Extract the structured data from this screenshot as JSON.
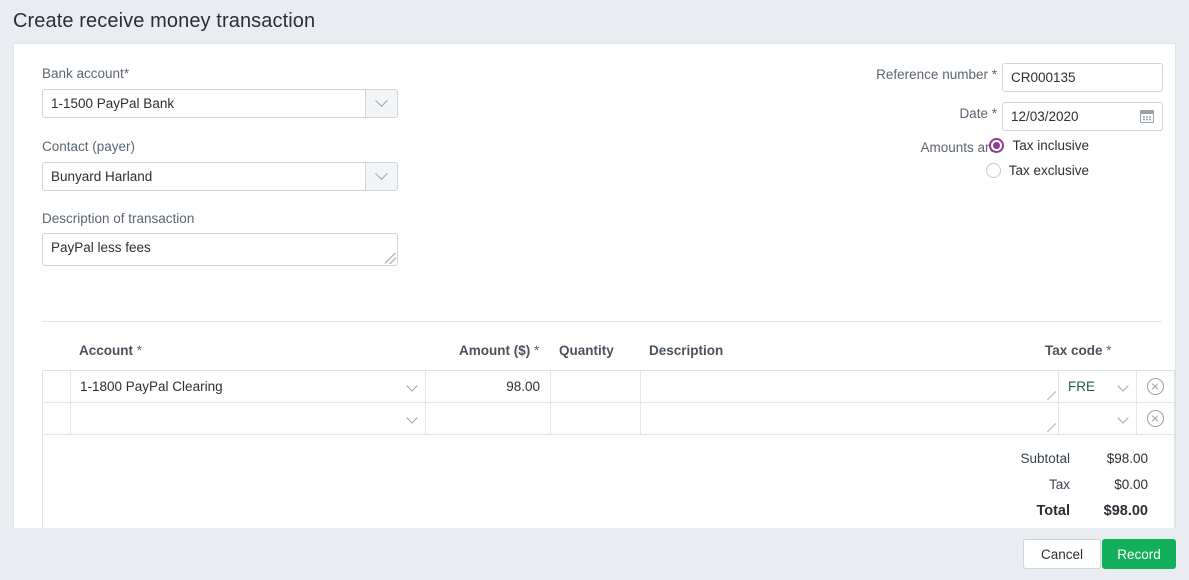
{
  "header": {
    "title": "Create receive money transaction"
  },
  "form": {
    "bank_account": {
      "label": "Bank account",
      "required": "*",
      "value": "1-1500 PayPal Bank",
      "chevron_icon": "chevron-down-icon"
    },
    "contact": {
      "label": "Contact (payer)",
      "required": "",
      "value": "Bunyard Harland",
      "chevron_icon": "chevron-down-icon"
    },
    "description": {
      "label": "Description of transaction",
      "value": "PayPal less fees"
    },
    "reference_number": {
      "label": "Reference number",
      "required": "*",
      "value": "CR000135"
    },
    "date": {
      "label": "Date",
      "required": "*",
      "value": "12/03/2020",
      "calendar_icon": "calendar-icon"
    },
    "amounts_are": {
      "label": "Amounts are",
      "options": [
        {
          "label": "Tax inclusive",
          "selected": true
        },
        {
          "label": "Tax exclusive",
          "selected": false
        }
      ]
    }
  },
  "line_items": {
    "columns": [
      {
        "key": "account",
        "label": "Account",
        "required": "*"
      },
      {
        "key": "amount",
        "label": "Amount ($)",
        "required": "*"
      },
      {
        "key": "quantity",
        "label": "Quantity",
        "required": ""
      },
      {
        "key": "description",
        "label": "Description",
        "required": ""
      },
      {
        "key": "tax_code",
        "label": "Tax code",
        "required": "*"
      }
    ],
    "rows": [
      {
        "account": "1-1800 PayPal Clearing",
        "amount": "98.00",
        "quantity": "",
        "description": "",
        "tax_code": "FRE",
        "delete_icon": "delete-circle-icon"
      },
      {
        "account": "",
        "amount": "",
        "quantity": "",
        "description": "",
        "tax_code": "",
        "delete_icon": "delete-circle-icon"
      }
    ]
  },
  "totals": [
    {
      "label": "Subtotal",
      "value": "$98.00"
    },
    {
      "label": "Tax",
      "value": "$0.00"
    },
    {
      "label": "Total",
      "value": "$98.00"
    }
  ],
  "footer": {
    "cancel_label": "Cancel",
    "record_label": "Record"
  },
  "colors": {
    "accent_radio": "#8e3a93",
    "record_button": "#13b05c",
    "tax_code_text": "#1f5e4b",
    "page_background": "#e9ecf1"
  }
}
